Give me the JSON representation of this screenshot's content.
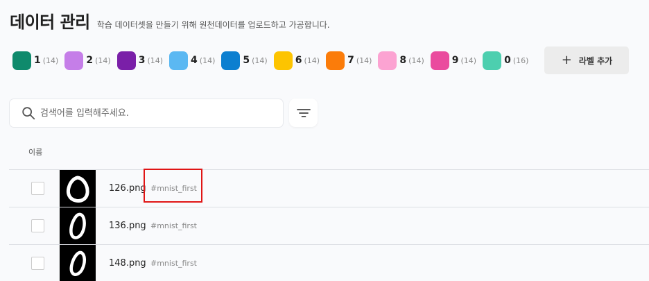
{
  "header": {
    "title": "데이터 관리",
    "description": "학습 데이터셋을 만들기 위해 원천데이터를 업로드하고 가공합니다."
  },
  "labels": [
    {
      "name": "1",
      "count": "(14)",
      "color": "#0f8a6c"
    },
    {
      "name": "2",
      "count": "(14)",
      "color": "#c57ee8"
    },
    {
      "name": "3",
      "count": "(14)",
      "color": "#7a1fa8"
    },
    {
      "name": "4",
      "count": "(14)",
      "color": "#5bb8f2"
    },
    {
      "name": "5",
      "count": "(14)",
      "color": "#0c7fd0"
    },
    {
      "name": "6",
      "count": "(14)",
      "color": "#fdc400"
    },
    {
      "name": "7",
      "count": "(14)",
      "color": "#fb7c0a"
    },
    {
      "name": "8",
      "count": "(14)",
      "color": "#fca3d2"
    },
    {
      "name": "9",
      "count": "(14)",
      "color": "#ea4b9e"
    },
    {
      "name": "0",
      "count": "(16)",
      "color": "#4dcfaf"
    }
  ],
  "add_label_button": {
    "icon": "+",
    "label": "라벨 추가"
  },
  "search": {
    "placeholder": "검색어를 입력해주세요."
  },
  "table": {
    "column_name": "이름",
    "rows": [
      {
        "filename": "126.png",
        "tag": "#mnist_first",
        "thumbnail": "digit-0-round",
        "highlighted": true
      },
      {
        "filename": "136.png",
        "tag": "#mnist_first",
        "thumbnail": "digit-0-narrow",
        "highlighted": false
      },
      {
        "filename": "148.png",
        "tag": "#mnist_first",
        "thumbnail": "digit-0-narrow",
        "highlighted": false
      }
    ]
  }
}
